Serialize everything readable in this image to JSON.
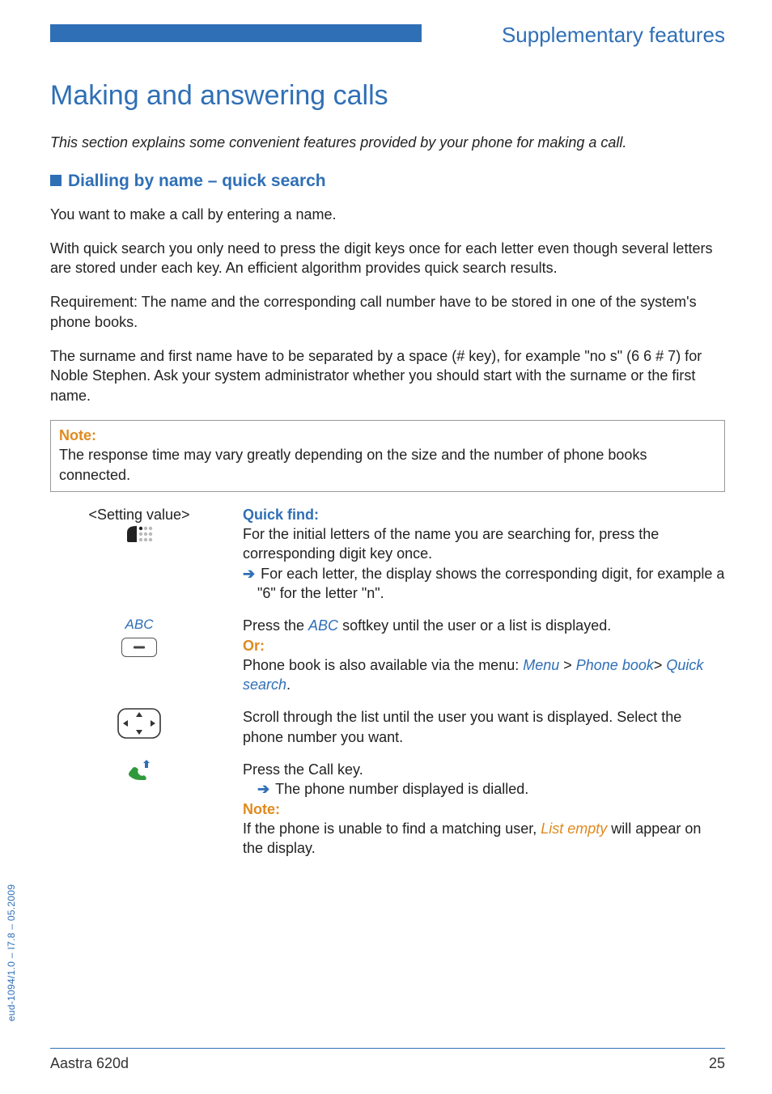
{
  "header": {
    "section": "Supplementary features"
  },
  "h1": "Making and answering calls",
  "intro": "This section explains some convenient features provided by your phone for making a call.",
  "h2": "Dialling by name – quick search",
  "p1": "You want to make a call by entering a name.",
  "p2": "With quick search you only need to press the digit keys once for each letter even though several letters are stored under each key. An efficient algorithm provides quick search results.",
  "p3": "Requirement: The name and the corresponding call number have to be stored in one of the system's phone books.",
  "p4": "The surname and first name have to be separated by a space (# key), for example \"no s\" (6 6 # 7) for Noble Stephen. Ask your system administrator whether you should start with the surname or the first name.",
  "note": {
    "label": "Note:",
    "text": "The response time may vary greatly depending on the size and the number of phone books connected."
  },
  "steps": {
    "s1": {
      "setting": "<Setting value>",
      "title": "Quick find:",
      "line1": "For the initial letters of the name you are searching for, press the corresponding digit key once.",
      "line2a": "For each letter, the display shows the corresponding digit, for example a \"6\" for the letter \"n\"."
    },
    "s2": {
      "abc": "ABC",
      "line_press_a": "Press the ",
      "line_press_softkey": "ABC",
      "line_press_b": " softkey until the user or a list is displayed.",
      "or": "Or:",
      "menu_a": "Phone book is also available via the menu: ",
      "menu_1": "Menu",
      "menu_sep1": " > ",
      "menu_2": "Phone book",
      "menu_sep2": "> ",
      "menu_3": "Quick search",
      "menu_end": "."
    },
    "s3": {
      "text": "Scroll through the list until the user you want is displayed. Select the phone number you want."
    },
    "s4": {
      "line1": "Press the Call key.",
      "line2": "The phone number displayed is dialled.",
      "note_label": "Note:",
      "line3a": "If the phone is unable to find a matching user, ",
      "line3_em": "List empty",
      "line3b": "  will appear on the display."
    }
  },
  "side": "eud-1094/1.0 – I7.8 – 05.2009",
  "footer": {
    "left": "Aastra 620d",
    "right": "25"
  }
}
